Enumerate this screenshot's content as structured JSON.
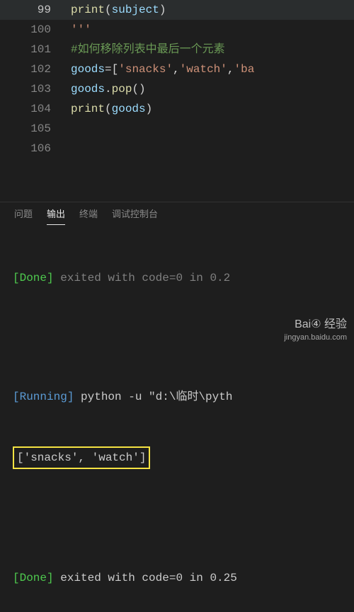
{
  "editor": {
    "lines": [
      {
        "num": "99",
        "hl": true,
        "tokens": [
          [
            "print",
            "tok-fn"
          ],
          [
            "(",
            "tok-paren"
          ],
          [
            "subject",
            "tok-var"
          ],
          [
            ")",
            "tok-paren"
          ]
        ]
      },
      {
        "num": "100",
        "hl": false,
        "tokens": [
          [
            "'''",
            "tok-str"
          ]
        ]
      },
      {
        "num": "101",
        "hl": false,
        "tokens": [
          [
            "#如何移除列表中最后一个元素",
            "tok-comment"
          ]
        ]
      },
      {
        "num": "102",
        "hl": false,
        "tokens": [
          [
            "goods",
            "tok-var"
          ],
          [
            "=",
            "tok-op"
          ],
          [
            "[",
            "tok-paren"
          ],
          [
            "'snacks'",
            "tok-str"
          ],
          [
            ",",
            "tok-op"
          ],
          [
            "'watch'",
            "tok-str"
          ],
          [
            ",",
            "tok-op"
          ],
          [
            "'ba",
            "tok-str"
          ]
        ]
      },
      {
        "num": "103",
        "hl": false,
        "tokens": [
          [
            "goods",
            "tok-var"
          ],
          [
            ".",
            "tok-op"
          ],
          [
            "pop",
            "tok-fn"
          ],
          [
            "()",
            "tok-paren"
          ]
        ]
      },
      {
        "num": "104",
        "hl": false,
        "tokens": [
          [
            "print",
            "tok-fn"
          ],
          [
            "(",
            "tok-paren"
          ],
          [
            "goods",
            "tok-var"
          ],
          [
            ")",
            "tok-paren"
          ]
        ]
      },
      {
        "num": "105",
        "hl": false,
        "tokens": []
      },
      {
        "num": "106",
        "hl": false,
        "tokens": []
      }
    ]
  },
  "tabs": {
    "problems": "问题",
    "output": "输出",
    "terminal": "终端",
    "debug_console": "调试控制台"
  },
  "term": {
    "l1a": "[Done]",
    "l1b": " exited with code=0 in 0.2",
    "l2a": "[Running]",
    "l2b": " python -u \"d:\\临时\\pyth",
    "l3": "['snacks', 'watch']",
    "l4a": "[Done]",
    "l4b": " exited with code=0 in 0.25"
  },
  "watermark": {
    "top": "Bai④ 经验",
    "bot": "jingyan.baidu.com"
  }
}
